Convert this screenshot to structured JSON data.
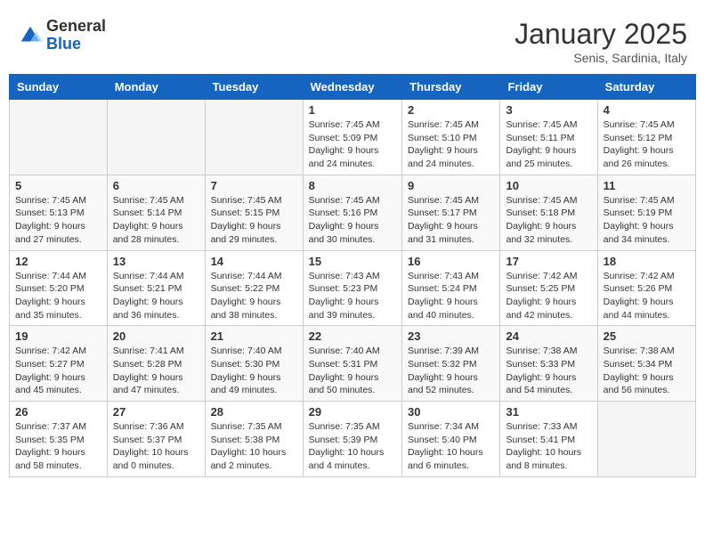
{
  "header": {
    "logo_general": "General",
    "logo_blue": "Blue",
    "month_title": "January 2025",
    "subtitle": "Senis, Sardinia, Italy"
  },
  "weekdays": [
    "Sunday",
    "Monday",
    "Tuesday",
    "Wednesday",
    "Thursday",
    "Friday",
    "Saturday"
  ],
  "weeks": [
    [
      {
        "day": "",
        "info": ""
      },
      {
        "day": "",
        "info": ""
      },
      {
        "day": "",
        "info": ""
      },
      {
        "day": "1",
        "info": "Sunrise: 7:45 AM\nSunset: 5:09 PM\nDaylight: 9 hours\nand 24 minutes."
      },
      {
        "day": "2",
        "info": "Sunrise: 7:45 AM\nSunset: 5:10 PM\nDaylight: 9 hours\nand 24 minutes."
      },
      {
        "day": "3",
        "info": "Sunrise: 7:45 AM\nSunset: 5:11 PM\nDaylight: 9 hours\nand 25 minutes."
      },
      {
        "day": "4",
        "info": "Sunrise: 7:45 AM\nSunset: 5:12 PM\nDaylight: 9 hours\nand 26 minutes."
      }
    ],
    [
      {
        "day": "5",
        "info": "Sunrise: 7:45 AM\nSunset: 5:13 PM\nDaylight: 9 hours\nand 27 minutes."
      },
      {
        "day": "6",
        "info": "Sunrise: 7:45 AM\nSunset: 5:14 PM\nDaylight: 9 hours\nand 28 minutes."
      },
      {
        "day": "7",
        "info": "Sunrise: 7:45 AM\nSunset: 5:15 PM\nDaylight: 9 hours\nand 29 minutes."
      },
      {
        "day": "8",
        "info": "Sunrise: 7:45 AM\nSunset: 5:16 PM\nDaylight: 9 hours\nand 30 minutes."
      },
      {
        "day": "9",
        "info": "Sunrise: 7:45 AM\nSunset: 5:17 PM\nDaylight: 9 hours\nand 31 minutes."
      },
      {
        "day": "10",
        "info": "Sunrise: 7:45 AM\nSunset: 5:18 PM\nDaylight: 9 hours\nand 32 minutes."
      },
      {
        "day": "11",
        "info": "Sunrise: 7:45 AM\nSunset: 5:19 PM\nDaylight: 9 hours\nand 34 minutes."
      }
    ],
    [
      {
        "day": "12",
        "info": "Sunrise: 7:44 AM\nSunset: 5:20 PM\nDaylight: 9 hours\nand 35 minutes."
      },
      {
        "day": "13",
        "info": "Sunrise: 7:44 AM\nSunset: 5:21 PM\nDaylight: 9 hours\nand 36 minutes."
      },
      {
        "day": "14",
        "info": "Sunrise: 7:44 AM\nSunset: 5:22 PM\nDaylight: 9 hours\nand 38 minutes."
      },
      {
        "day": "15",
        "info": "Sunrise: 7:43 AM\nSunset: 5:23 PM\nDaylight: 9 hours\nand 39 minutes."
      },
      {
        "day": "16",
        "info": "Sunrise: 7:43 AM\nSunset: 5:24 PM\nDaylight: 9 hours\nand 40 minutes."
      },
      {
        "day": "17",
        "info": "Sunrise: 7:42 AM\nSunset: 5:25 PM\nDaylight: 9 hours\nand 42 minutes."
      },
      {
        "day": "18",
        "info": "Sunrise: 7:42 AM\nSunset: 5:26 PM\nDaylight: 9 hours\nand 44 minutes."
      }
    ],
    [
      {
        "day": "19",
        "info": "Sunrise: 7:42 AM\nSunset: 5:27 PM\nDaylight: 9 hours\nand 45 minutes."
      },
      {
        "day": "20",
        "info": "Sunrise: 7:41 AM\nSunset: 5:28 PM\nDaylight: 9 hours\nand 47 minutes."
      },
      {
        "day": "21",
        "info": "Sunrise: 7:40 AM\nSunset: 5:30 PM\nDaylight: 9 hours\nand 49 minutes."
      },
      {
        "day": "22",
        "info": "Sunrise: 7:40 AM\nSunset: 5:31 PM\nDaylight: 9 hours\nand 50 minutes."
      },
      {
        "day": "23",
        "info": "Sunrise: 7:39 AM\nSunset: 5:32 PM\nDaylight: 9 hours\nand 52 minutes."
      },
      {
        "day": "24",
        "info": "Sunrise: 7:38 AM\nSunset: 5:33 PM\nDaylight: 9 hours\nand 54 minutes."
      },
      {
        "day": "25",
        "info": "Sunrise: 7:38 AM\nSunset: 5:34 PM\nDaylight: 9 hours\nand 56 minutes."
      }
    ],
    [
      {
        "day": "26",
        "info": "Sunrise: 7:37 AM\nSunset: 5:35 PM\nDaylight: 9 hours\nand 58 minutes."
      },
      {
        "day": "27",
        "info": "Sunrise: 7:36 AM\nSunset: 5:37 PM\nDaylight: 10 hours\nand 0 minutes."
      },
      {
        "day": "28",
        "info": "Sunrise: 7:35 AM\nSunset: 5:38 PM\nDaylight: 10 hours\nand 2 minutes."
      },
      {
        "day": "29",
        "info": "Sunrise: 7:35 AM\nSunset: 5:39 PM\nDaylight: 10 hours\nand 4 minutes."
      },
      {
        "day": "30",
        "info": "Sunrise: 7:34 AM\nSunset: 5:40 PM\nDaylight: 10 hours\nand 6 minutes."
      },
      {
        "day": "31",
        "info": "Sunrise: 7:33 AM\nSunset: 5:41 PM\nDaylight: 10 hours\nand 8 minutes."
      },
      {
        "day": "",
        "info": ""
      }
    ]
  ]
}
